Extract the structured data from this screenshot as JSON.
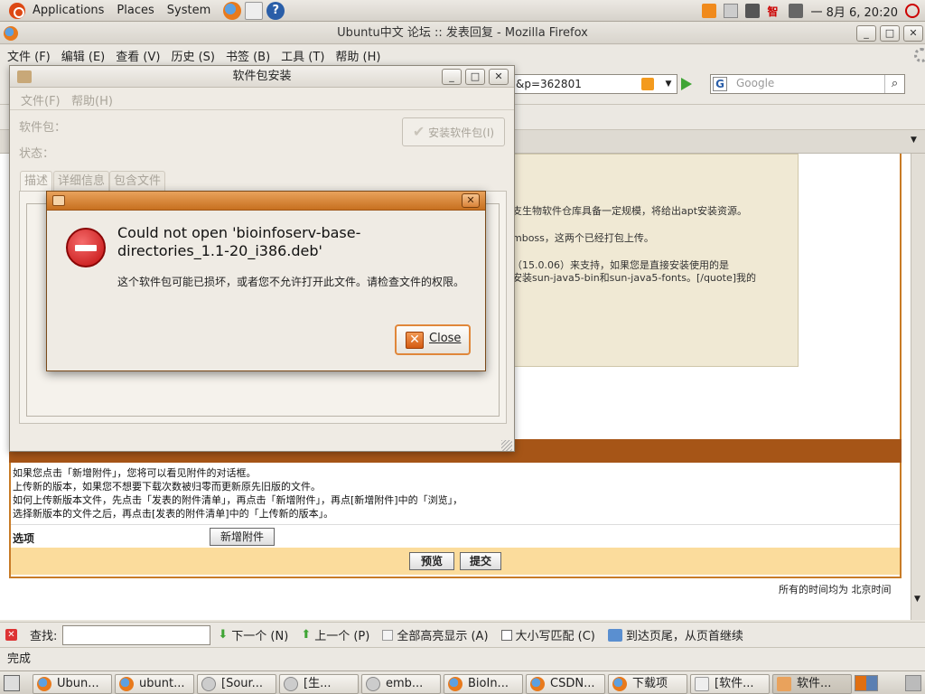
{
  "top_panel": {
    "menus": [
      "Applications",
      "Places",
      "System"
    ],
    "clock": "一 8月  6, 20:20"
  },
  "firefox": {
    "window_title": "Ubuntu中文 论坛 :: 发表回复 - Mozilla Firefox",
    "menus": [
      "文件 (F)",
      "编辑 (E)",
      "查看 (V)",
      "历史 (S)",
      "书签 (B)",
      "工具 (T)",
      "帮助 (H)"
    ],
    "url_fragment": "&p=362801",
    "search_placeholder": "Google",
    "page": {
      "quote_lines": [
        "支生物软件仓库具备一定规模，将给出apt安装资源。",
        "mboss，这两个已经打包上传。",
        "（15.0.06）来支持，如果您是直接安装使用的是",
        "安装sun-java5-bin和sun-java5-fonts。[/quote]我的"
      ],
      "help_lines": [
        "如果您点击「新增附件」，您将可以看见附件的对话框。",
        "上传新的版本，如果您不想要下载次数被归零而更新原先旧版的文件。",
        "如何上传新版本文件，先点击「发表的附件清单」，再点击「新增附件」，再点[新增附件]中的「浏览」，",
        "选择新版本的文件之后，再点击[发表的附件清单]中的「上传新的版本」。"
      ],
      "options_label": "选项",
      "add_attachment": "新增附件",
      "preview": "预览",
      "submit": "提交",
      "timezone_note": "所有的时间均为 北京时间"
    },
    "find_bar": {
      "label": "查找:",
      "next": "下一个 (N)",
      "prev": "上一个 (P)",
      "highlight_all": "全部高亮显示 (A)",
      "match_case": "大小写匹配 (C)",
      "wrap_note": "到达页尾，从页首继续"
    },
    "status": "完成"
  },
  "pkg_installer": {
    "title": "软件包安装",
    "menus": [
      "文件(F)",
      "帮助(H)"
    ],
    "package_label": "软件包：",
    "status_label": "状态：",
    "install_button": "安装软件包(I)",
    "tabs": [
      "描述",
      "详细信息",
      "包含文件"
    ]
  },
  "error_dialog": {
    "heading": "Could not open 'bioinfoserv-base-directories_1.1-20_i386.deb'",
    "body": "这个软件包可能已损坏，或者您不允许打开此文件。请检查文件的权限。",
    "close_button": "Close"
  },
  "taskbar": {
    "items": [
      "Ubun...",
      "ubunt...",
      "[Sour...",
      "[生...",
      "emb...",
      "BioIn...",
      "CSDN...",
      "下载项",
      "[软件...",
      "软件..."
    ]
  }
}
